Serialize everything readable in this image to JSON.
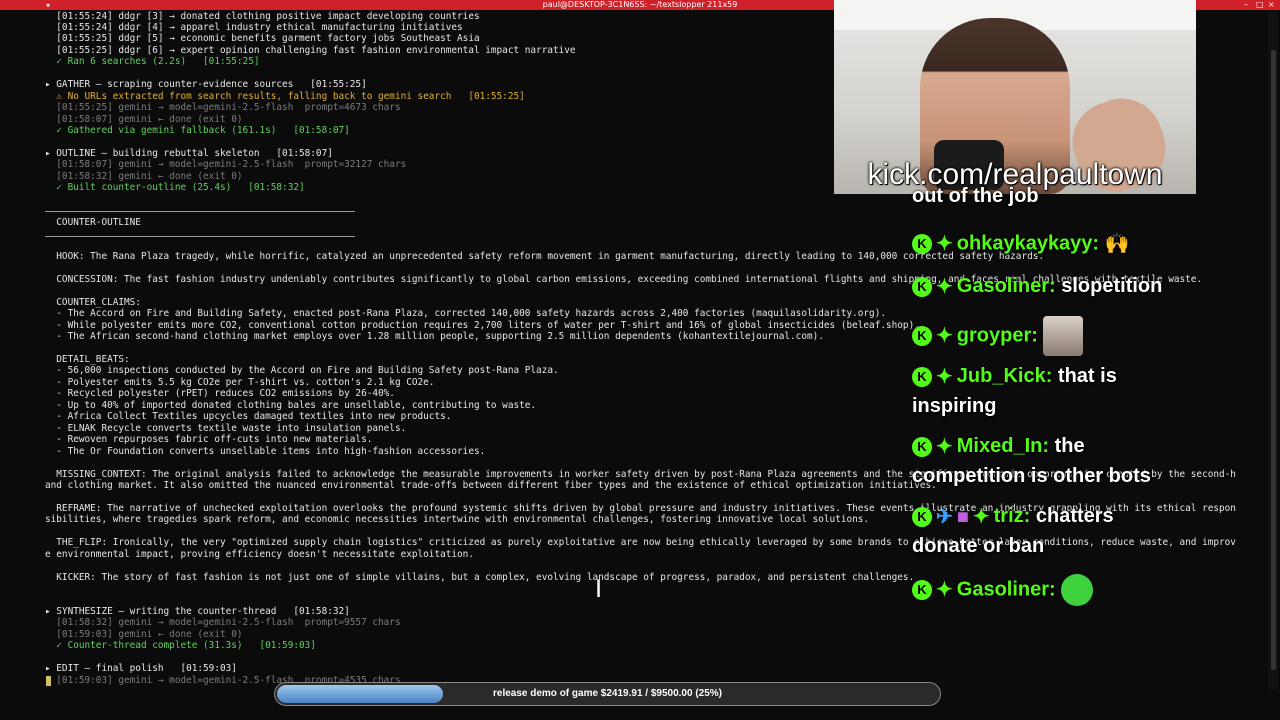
{
  "window": {
    "title": "paul@DESKTOP-3C1N6SS: ~/textslopper 211x59"
  },
  "terminal": {
    "lines": [
      {
        "cls": "white",
        "text": "  [01:55:24] ddgr [3] → donated clothing positive impact developing countries"
      },
      {
        "cls": "white",
        "text": "  [01:55:24] ddgr [4] → apparel industry ethical manufacturing initiatives"
      },
      {
        "cls": "white",
        "text": "  [01:55:25] ddgr [5] → economic benefits garment factory jobs Southeast Asia"
      },
      {
        "cls": "white",
        "text": "  [01:55:25] ddgr [6] → expert opinion challenging fast fashion environmental impact narrative"
      },
      {
        "cls": "green",
        "text": "  ✓ Ran 6 searches (2.2s)   [01:55:25]"
      },
      {
        "cls": "blank",
        "text": ""
      },
      {
        "cls": "head",
        "text": "▸ GATHER — scraping counter-evidence sources   [01:55:25]"
      },
      {
        "cls": "yellow",
        "text": "  ⚠ No URLs extracted from search results, falling back to gemini search   [01:55:25]"
      },
      {
        "cls": "gray",
        "text": "  [01:55:25] gemini → model=gemini-2.5-flash  prompt=4673 chars"
      },
      {
        "cls": "gray",
        "text": "  [01:58:07] gemini ← done (exit 0)"
      },
      {
        "cls": "green",
        "text": "  ✓ Gathered via gemini fallback (161.1s)   [01:58:07]"
      },
      {
        "cls": "blank",
        "text": ""
      },
      {
        "cls": "head",
        "text": "▸ OUTLINE — building rebuttal skeleton   [01:58:07]"
      },
      {
        "cls": "gray",
        "text": "  [01:58:07] gemini → model=gemini-2.5-flash  prompt=32127 chars"
      },
      {
        "cls": "gray",
        "text": "  [01:58:32] gemini ← done (exit 0)"
      },
      {
        "cls": "green",
        "text": "  ✓ Built counter-outline (25.4s)   [01:58:32]"
      },
      {
        "cls": "blank",
        "text": ""
      },
      {
        "cls": "blank",
        "text": ""
      },
      {
        "cls": "white",
        "text": "  COUNTER-OUTLINE"
      },
      {
        "cls": "blank",
        "text": ""
      },
      {
        "cls": "blank",
        "text": ""
      },
      {
        "cls": "white",
        "text": "  HOOK: The Rana Plaza tragedy, while horrific, catalyzed an unprecedented safety reform movement in garment manufacturing, directly leading to 140,000 corrected safety hazards."
      },
      {
        "cls": "blank",
        "text": ""
      },
      {
        "cls": "white",
        "text": "  CONCESSION: The fast fashion industry undeniably contributes significantly to global carbon emissions, exceeding combined international flights and shipping, and faces real challenges with textile waste."
      },
      {
        "cls": "blank",
        "text": ""
      },
      {
        "cls": "white",
        "text": "  COUNTER_CLAIMS:"
      },
      {
        "cls": "white",
        "text": "  - The Accord on Fire and Building Safety, enacted post-Rana Plaza, corrected 140,000 safety hazards across 2,400 factories (maquilasolidarity.org)."
      },
      {
        "cls": "white",
        "text": "  - While polyester emits more CO2, conventional cotton production requires 2,700 liters of water per T-shirt and 16% of global insecticides (beleaf.shop)."
      },
      {
        "cls": "white",
        "text": "  - The African second-hand clothing market employs over 1.28 million people, supporting 2.5 million dependents (kohantextilejournal.com)."
      },
      {
        "cls": "blank",
        "text": ""
      },
      {
        "cls": "white",
        "text": "  DETAIL_BEATS:"
      },
      {
        "cls": "white",
        "text": "  - 56,000 inspections conducted by the Accord on Fire and Building Safety post-Rana Plaza."
      },
      {
        "cls": "white",
        "text": "  - Polyester emits 5.5 kg CO2e per T-shirt vs. cotton's 2.1 kg CO2e."
      },
      {
        "cls": "white",
        "text": "  - Recycled polyester (rPET) reduces CO2 emissions by 26-40%."
      },
      {
        "cls": "white",
        "text": "  - Up to 40% of imported donated clothing bales are unsellable, contributing to waste."
      },
      {
        "cls": "white",
        "text": "  - Africa Collect Textiles upcycles damaged textiles into new products."
      },
      {
        "cls": "white",
        "text": "  - ELNAK Recycle converts textile waste into insulation panels."
      },
      {
        "cls": "white",
        "text": "  - Rewoven repurposes fabric off-cuts into new materials."
      },
      {
        "cls": "white",
        "text": "  - The Or Foundation converts unsellable items into high-fashion accessories."
      },
      {
        "cls": "blank",
        "text": ""
      },
      {
        "cls": "white",
        "text": "  MISSING_CONTEXT: The original analysis failed to acknowledge the measurable improvements in worker safety driven by post-Rana Plaza agreements and the significant economic opportunities created by the second-h"
      },
      {
        "cls": "white",
        "text": "and clothing market. It also omitted the nuanced environmental trade-offs between different fiber types and the existence of ethical optimization initiatives."
      },
      {
        "cls": "blank",
        "text": ""
      },
      {
        "cls": "white",
        "text": "  REFRAME: The narrative of unchecked exploitation overlooks the profound systemic shifts driven by global pressure and industry initiatives. These events illustrate an industry grappling with its ethical respon"
      },
      {
        "cls": "white",
        "text": "sibilities, where tragedies spark reform, and economic necessities intertwine with environmental challenges, fostering innovative local solutions."
      },
      {
        "cls": "blank",
        "text": ""
      },
      {
        "cls": "white",
        "text": "  THE_FLIP: Ironically, the very \"optimized supply chain logistics\" criticized as purely exploitative are now being ethically leveraged by some brands to achieve better labor conditions, reduce waste, and improv"
      },
      {
        "cls": "white",
        "text": "e environmental impact, proving efficiency doesn't necessitate exploitation."
      },
      {
        "cls": "blank",
        "text": ""
      },
      {
        "cls": "white",
        "text": "  KICKER: The story of fast fashion is not just one of simple villains, but a complex, evolving landscape of progress, paradox, and persistent challenges."
      },
      {
        "cls": "blank",
        "text": ""
      },
      {
        "cls": "blank",
        "text": ""
      },
      {
        "cls": "head",
        "text": "▸ SYNTHESIZE — writing the counter-thread   [01:58:32]"
      },
      {
        "cls": "gray",
        "text": "  [01:58:32] gemini → model=gemini-2.5-flash  prompt=9557 chars"
      },
      {
        "cls": "gray",
        "text": "  [01:59:03] gemini ← done (exit 0)"
      },
      {
        "cls": "green",
        "text": "  ✓ Counter-thread complete (31.3s)   [01:59:03]"
      },
      {
        "cls": "blank",
        "text": ""
      },
      {
        "cls": "head",
        "text": "▸ EDIT — final polish   [01:59:03]"
      },
      {
        "cls": "gray",
        "text": "  [01:59:03] gemini → model=gemini-2.5-flash  prompt=4535 chars"
      }
    ]
  },
  "overlay": {
    "stream_url": "kick.com/realpaultown",
    "chat": [
      {
        "user": "",
        "text": "out of the job",
        "partial": true
      },
      {
        "user": "ohkaykaykayy:",
        "text": "",
        "emote": "hands-emote"
      },
      {
        "user": "Gasoliner:",
        "text": "slopetition"
      },
      {
        "user": "groyper:",
        "text": "",
        "emote": "face-emote"
      },
      {
        "user": "Jub_Kick:",
        "text": "that is"
      },
      {
        "user": "",
        "text": "inspiring",
        "cont": true
      },
      {
        "user": "Mixed_In:",
        "text": "the"
      },
      {
        "user": "",
        "text": "competition is other bots",
        "cont": true
      },
      {
        "user": "triz:",
        "text": "chatters",
        "extra_badges": true
      },
      {
        "user": "",
        "text": "donate or ban",
        "cont": true
      },
      {
        "user": "Gasoliner:",
        "text": "",
        "emote": "green-smile-emote"
      }
    ],
    "progress": {
      "label": "release demo of game $2419.91 / $9500.00 (25%)",
      "fraction": 0.25
    }
  },
  "colors": {
    "titlebar": "#d0202a",
    "kick_green": "#53fc18",
    "progress_fill": "#6aa0dc"
  }
}
